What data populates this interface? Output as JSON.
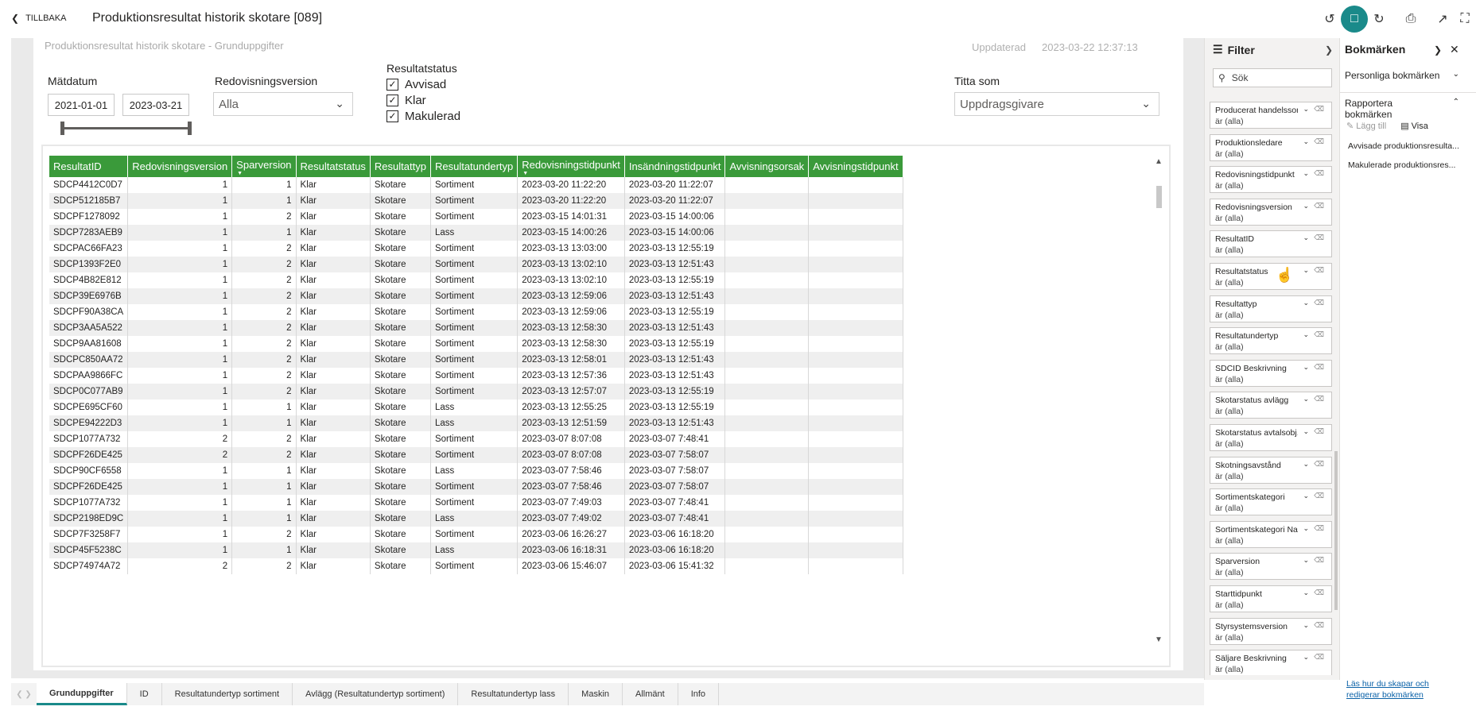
{
  "topbar": {
    "back_label": "TILLBAKA",
    "title": "Produktionsresultat historik skotare [089]"
  },
  "report": {
    "subtitle": "Produktionsresultat historik skotare - Grunduppgifter",
    "updated_label": "Uppdaterad",
    "updated_value": "2023-03-22 12:37:13",
    "matdatum_label": "Mätdatum",
    "date_from": "2021-01-01",
    "date_to": "2023-03-21",
    "redovisningsversion_label": "Redovisningsversion",
    "redovisningsversion_value": "Alla",
    "resultatstatus_label": "Resultatstatus",
    "status_options": [
      "Avvisad",
      "Klar",
      "Makulerad"
    ],
    "titta_som_label": "Titta som",
    "titta_som_value": "Uppdragsgivare"
  },
  "table": {
    "headers": [
      "ResultatID",
      "Redovisningsversion",
      "Sparversion",
      "Resultatstatus",
      "Resultattyp",
      "Resultatundertyp",
      "Redovisningstidpunkt",
      "Insändningstidpunkt",
      "Avvisningsorsak",
      "Avvisningstidpunkt"
    ],
    "rows": [
      [
        "SDCP4412C0D7",
        "1",
        "1",
        "Klar",
        "Skotare",
        "Sortiment",
        "2023-03-20 11:22:20",
        "2023-03-20 11:22:07",
        "",
        ""
      ],
      [
        "SDCP512185B7",
        "1",
        "1",
        "Klar",
        "Skotare",
        "Sortiment",
        "2023-03-20 11:22:20",
        "2023-03-20 11:22:07",
        "",
        ""
      ],
      [
        "SDCPF1278092",
        "1",
        "2",
        "Klar",
        "Skotare",
        "Sortiment",
        "2023-03-15 14:01:31",
        "2023-03-15 14:00:06",
        "",
        ""
      ],
      [
        "SDCP7283AEB9",
        "1",
        "1",
        "Klar",
        "Skotare",
        "Lass",
        "2023-03-15 14:00:26",
        "2023-03-15 14:00:06",
        "",
        ""
      ],
      [
        "SDCPAC66FA23",
        "1",
        "2",
        "Klar",
        "Skotare",
        "Sortiment",
        "2023-03-13 13:03:00",
        "2023-03-13 12:55:19",
        "",
        ""
      ],
      [
        "SDCP1393F2E0",
        "1",
        "2",
        "Klar",
        "Skotare",
        "Sortiment",
        "2023-03-13 13:02:10",
        "2023-03-13 12:51:43",
        "",
        ""
      ],
      [
        "SDCP4B82E812",
        "1",
        "2",
        "Klar",
        "Skotare",
        "Sortiment",
        "2023-03-13 13:02:10",
        "2023-03-13 12:55:19",
        "",
        ""
      ],
      [
        "SDCP39E6976B",
        "1",
        "2",
        "Klar",
        "Skotare",
        "Sortiment",
        "2023-03-13 12:59:06",
        "2023-03-13 12:51:43",
        "",
        ""
      ],
      [
        "SDCPF90A38CA",
        "1",
        "2",
        "Klar",
        "Skotare",
        "Sortiment",
        "2023-03-13 12:59:06",
        "2023-03-13 12:55:19",
        "",
        ""
      ],
      [
        "SDCP3AA5A522",
        "1",
        "2",
        "Klar",
        "Skotare",
        "Sortiment",
        "2023-03-13 12:58:30",
        "2023-03-13 12:51:43",
        "",
        ""
      ],
      [
        "SDCP9AA81608",
        "1",
        "2",
        "Klar",
        "Skotare",
        "Sortiment",
        "2023-03-13 12:58:30",
        "2023-03-13 12:55:19",
        "",
        ""
      ],
      [
        "SDCPC850AA72",
        "1",
        "2",
        "Klar",
        "Skotare",
        "Sortiment",
        "2023-03-13 12:58:01",
        "2023-03-13 12:51:43",
        "",
        ""
      ],
      [
        "SDCPAA9866FC",
        "1",
        "2",
        "Klar",
        "Skotare",
        "Sortiment",
        "2023-03-13 12:57:36",
        "2023-03-13 12:51:43",
        "",
        ""
      ],
      [
        "SDCP0C077AB9",
        "1",
        "2",
        "Klar",
        "Skotare",
        "Sortiment",
        "2023-03-13 12:57:07",
        "2023-03-13 12:55:19",
        "",
        ""
      ],
      [
        "SDCPE695CF60",
        "1",
        "1",
        "Klar",
        "Skotare",
        "Lass",
        "2023-03-13 12:55:25",
        "2023-03-13 12:55:19",
        "",
        ""
      ],
      [
        "SDCPE94222D3",
        "1",
        "1",
        "Klar",
        "Skotare",
        "Lass",
        "2023-03-13 12:51:59",
        "2023-03-13 12:51:43",
        "",
        ""
      ],
      [
        "SDCP1077A732",
        "2",
        "2",
        "Klar",
        "Skotare",
        "Sortiment",
        "2023-03-07 8:07:08",
        "2023-03-07 7:48:41",
        "",
        ""
      ],
      [
        "SDCPF26DE425",
        "2",
        "2",
        "Klar",
        "Skotare",
        "Sortiment",
        "2023-03-07 8:07:08",
        "2023-03-07 7:58:07",
        "",
        ""
      ],
      [
        "SDCP90CF6558",
        "1",
        "1",
        "Klar",
        "Skotare",
        "Lass",
        "2023-03-07 7:58:46",
        "2023-03-07 7:58:07",
        "",
        ""
      ],
      [
        "SDCPF26DE425",
        "1",
        "1",
        "Klar",
        "Skotare",
        "Sortiment",
        "2023-03-07 7:58:46",
        "2023-03-07 7:58:07",
        "",
        ""
      ],
      [
        "SDCP1077A732",
        "1",
        "1",
        "Klar",
        "Skotare",
        "Sortiment",
        "2023-03-07 7:49:03",
        "2023-03-07 7:48:41",
        "",
        ""
      ],
      [
        "SDCP2198ED9C",
        "1",
        "1",
        "Klar",
        "Skotare",
        "Lass",
        "2023-03-07 7:49:02",
        "2023-03-07 7:48:41",
        "",
        ""
      ],
      [
        "SDCP7F3258F7",
        "1",
        "2",
        "Klar",
        "Skotare",
        "Sortiment",
        "2023-03-06 16:26:27",
        "2023-03-06 16:18:20",
        "",
        ""
      ],
      [
        "SDCP45F5238C",
        "1",
        "1",
        "Klar",
        "Skotare",
        "Lass",
        "2023-03-06 16:18:31",
        "2023-03-06 16:18:20",
        "",
        ""
      ],
      [
        "SDCP74974A72",
        "2",
        "2",
        "Klar",
        "Skotare",
        "Sortiment",
        "2023-03-06 15:46:07",
        "2023-03-06 15:41:32",
        "",
        ""
      ]
    ]
  },
  "tabs": [
    "Grunduppgifter",
    "ID",
    "Resultatundertyp sortiment",
    "Avlägg (Resultatundertyp sortiment)",
    "Resultatundertyp lass",
    "Maskin",
    "Allmänt",
    "Info"
  ],
  "filter": {
    "title": "Filter",
    "search_placeholder": "Sök",
    "all_label": "är (alla)",
    "cards": [
      "Producerat handelssort...",
      "Produktionsledare",
      "Redovisningstidpunkt",
      "Redovisningsversion",
      "ResultatID",
      "Resultatstatus",
      "Resultattyp",
      "Resultatundertyp",
      "SDCID Beskrivning",
      "Skotarstatus avlägg",
      "Skotarstatus avtalsobj...",
      "Skotningsavstånd",
      "Sortimentskategori",
      "Sortimentskategori Na...",
      "Sparversion",
      "Starttidpunkt",
      "Styrsystemsversion",
      "Säljare Beskrivning"
    ]
  },
  "bookmarks": {
    "title": "Bokmärken",
    "personal": "Personliga bokmärken",
    "report_line1": "Rapportera",
    "report_line2": "bokmärken",
    "add": "Lägg till",
    "show": "Visa",
    "items": [
      "Avvisade produktionsresulta...",
      "Makulerade produktionsres..."
    ],
    "help_line1": "Läs hur du skapar och",
    "help_line2": "redigerar bokmärken"
  },
  "colors": {
    "header_green": "#3a9a3a",
    "accent_teal": "#1a8a8a"
  }
}
